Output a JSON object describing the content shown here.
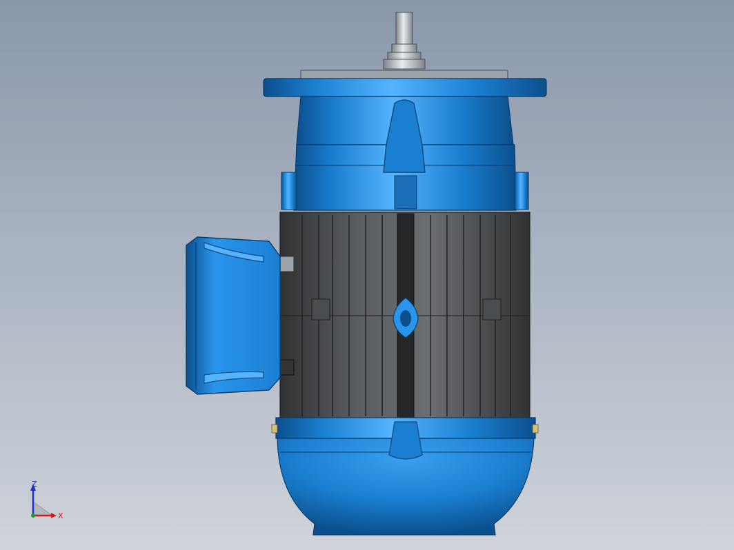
{
  "viewport": {
    "background_top": "#8a97ab",
    "background_bottom": "#cfd4db"
  },
  "motor": {
    "body_blue": "#1a7fd1",
    "body_blue_light": "#56b4ff",
    "body_blue_dark": "#0b4f8c",
    "stator_grey": "#5a5d60",
    "stator_grey_dark": "#2f3133",
    "shaft_grey": "#b9c0c6"
  },
  "triad": {
    "axis_z_label": "Z",
    "axis_x_label": "X",
    "axis_z_color": "#1a2fd1",
    "axis_x_color": "#d11a1a",
    "axis_y_color": "#1aa31a"
  }
}
